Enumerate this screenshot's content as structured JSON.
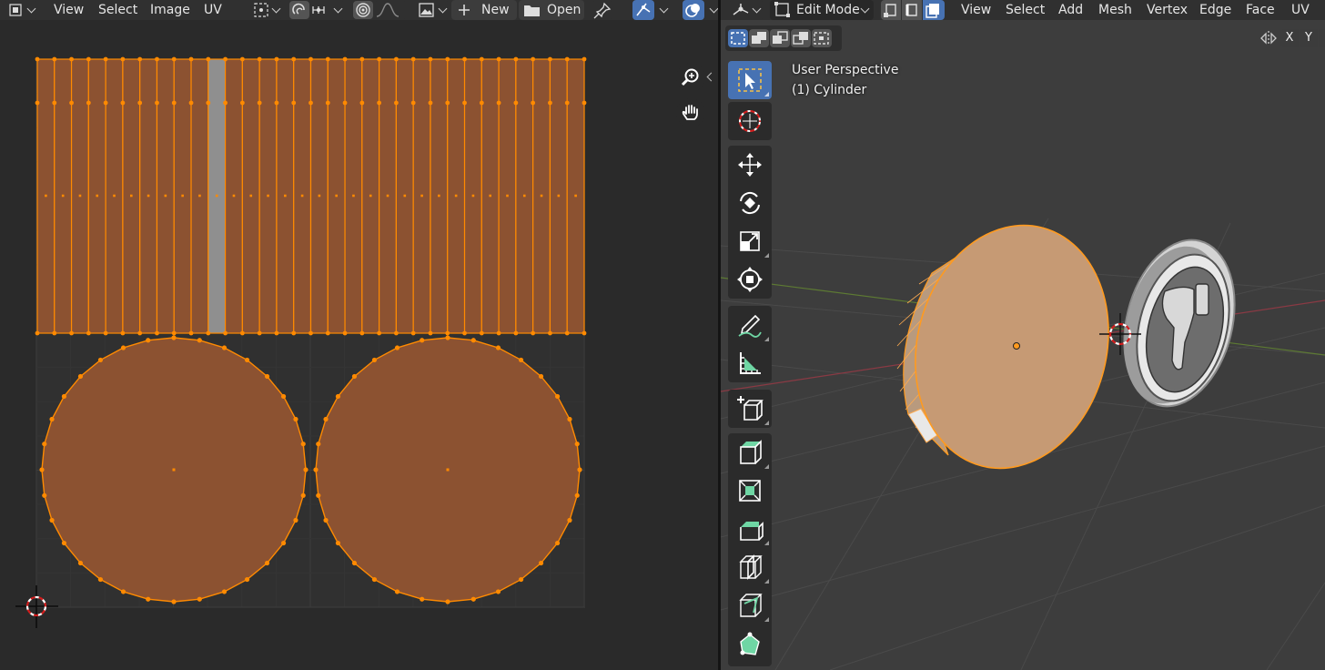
{
  "uv_editor": {
    "header": {
      "menu": [
        "View",
        "Select",
        "Image",
        "UV"
      ],
      "new_label": "New",
      "open_label": "Open"
    },
    "icons": [
      "editor-type-icon",
      "pivot-icon",
      "uv-sync-icon",
      "snap-icon",
      "proportional-icon",
      "falloff-icon",
      "image-browse-icon",
      "plus-icon",
      "folder-icon",
      "pin-icon",
      "gizmo-icon",
      "overlay-icon"
    ]
  },
  "viewport": {
    "header": {
      "mode_label": "Edit Mode",
      "menu": [
        "View",
        "Select",
        "Add",
        "Mesh",
        "Vertex",
        "Edge",
        "Face",
        "UV"
      ]
    },
    "overlay": {
      "perspective_label": "User Perspective",
      "object_label": "(1) Cylinder"
    },
    "axis_buttons": [
      "X",
      "Y"
    ],
    "toolbar": [
      "select-box",
      "cursor",
      "move",
      "rotate",
      "scale",
      "transform",
      "annotate",
      "measure",
      "add-cube",
      "extrude-region",
      "inset-faces",
      "bevel",
      "loop-cut",
      "knife",
      "poly-build"
    ]
  },
  "colors": {
    "accent": "#4772b3",
    "uv_face": "#8c5231",
    "uv_edge": "#ff8a00",
    "selected_face": "#e8b689"
  }
}
